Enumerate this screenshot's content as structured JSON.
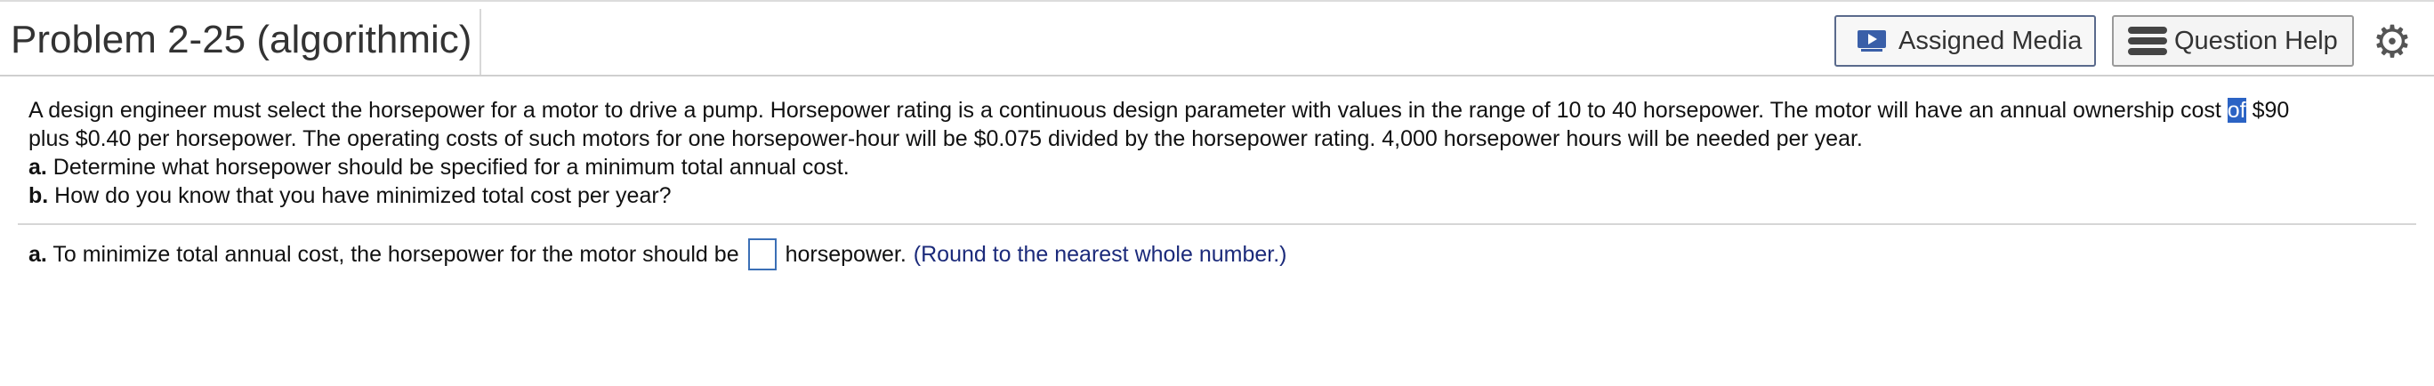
{
  "header": {
    "title": "Problem 2-25 (algorithmic)",
    "assigned_media_label": "Assigned Media",
    "question_help_label": "Question Help",
    "settings_icon": "gear-icon"
  },
  "question": {
    "line1_before": "A design engineer must select the horsepower for a motor to drive a pump. Horsepower rating is a continuous design parameter with values in the range of 10 to 40 horsepower. The motor will have an annual ownership cost ",
    "line1_highlight": "of",
    "line1_after": " $90",
    "line2": "plus $0.40 per horsepower. The operating costs of such motors for one horsepower-hour will be $0.075 divided by the horsepower rating. 4,000 horsepower hours will be needed per year.",
    "part_a_label": "a.",
    "part_a_text": " Determine what horsepower should be specified for a minimum total annual cost.",
    "part_b_label": "b.",
    "part_b_text": " How do you know that you have minimized total cost per year?"
  },
  "answer": {
    "part_label": "a.",
    "prompt": " To minimize total annual cost, the horsepower for the motor should be",
    "input_value": "",
    "unit": "horsepower.",
    "hint": "(Round to the nearest whole number.)"
  },
  "colors": {
    "highlight": "#2b63c4",
    "hint": "#1b2a7a",
    "input_border": "#3b6fb6"
  }
}
